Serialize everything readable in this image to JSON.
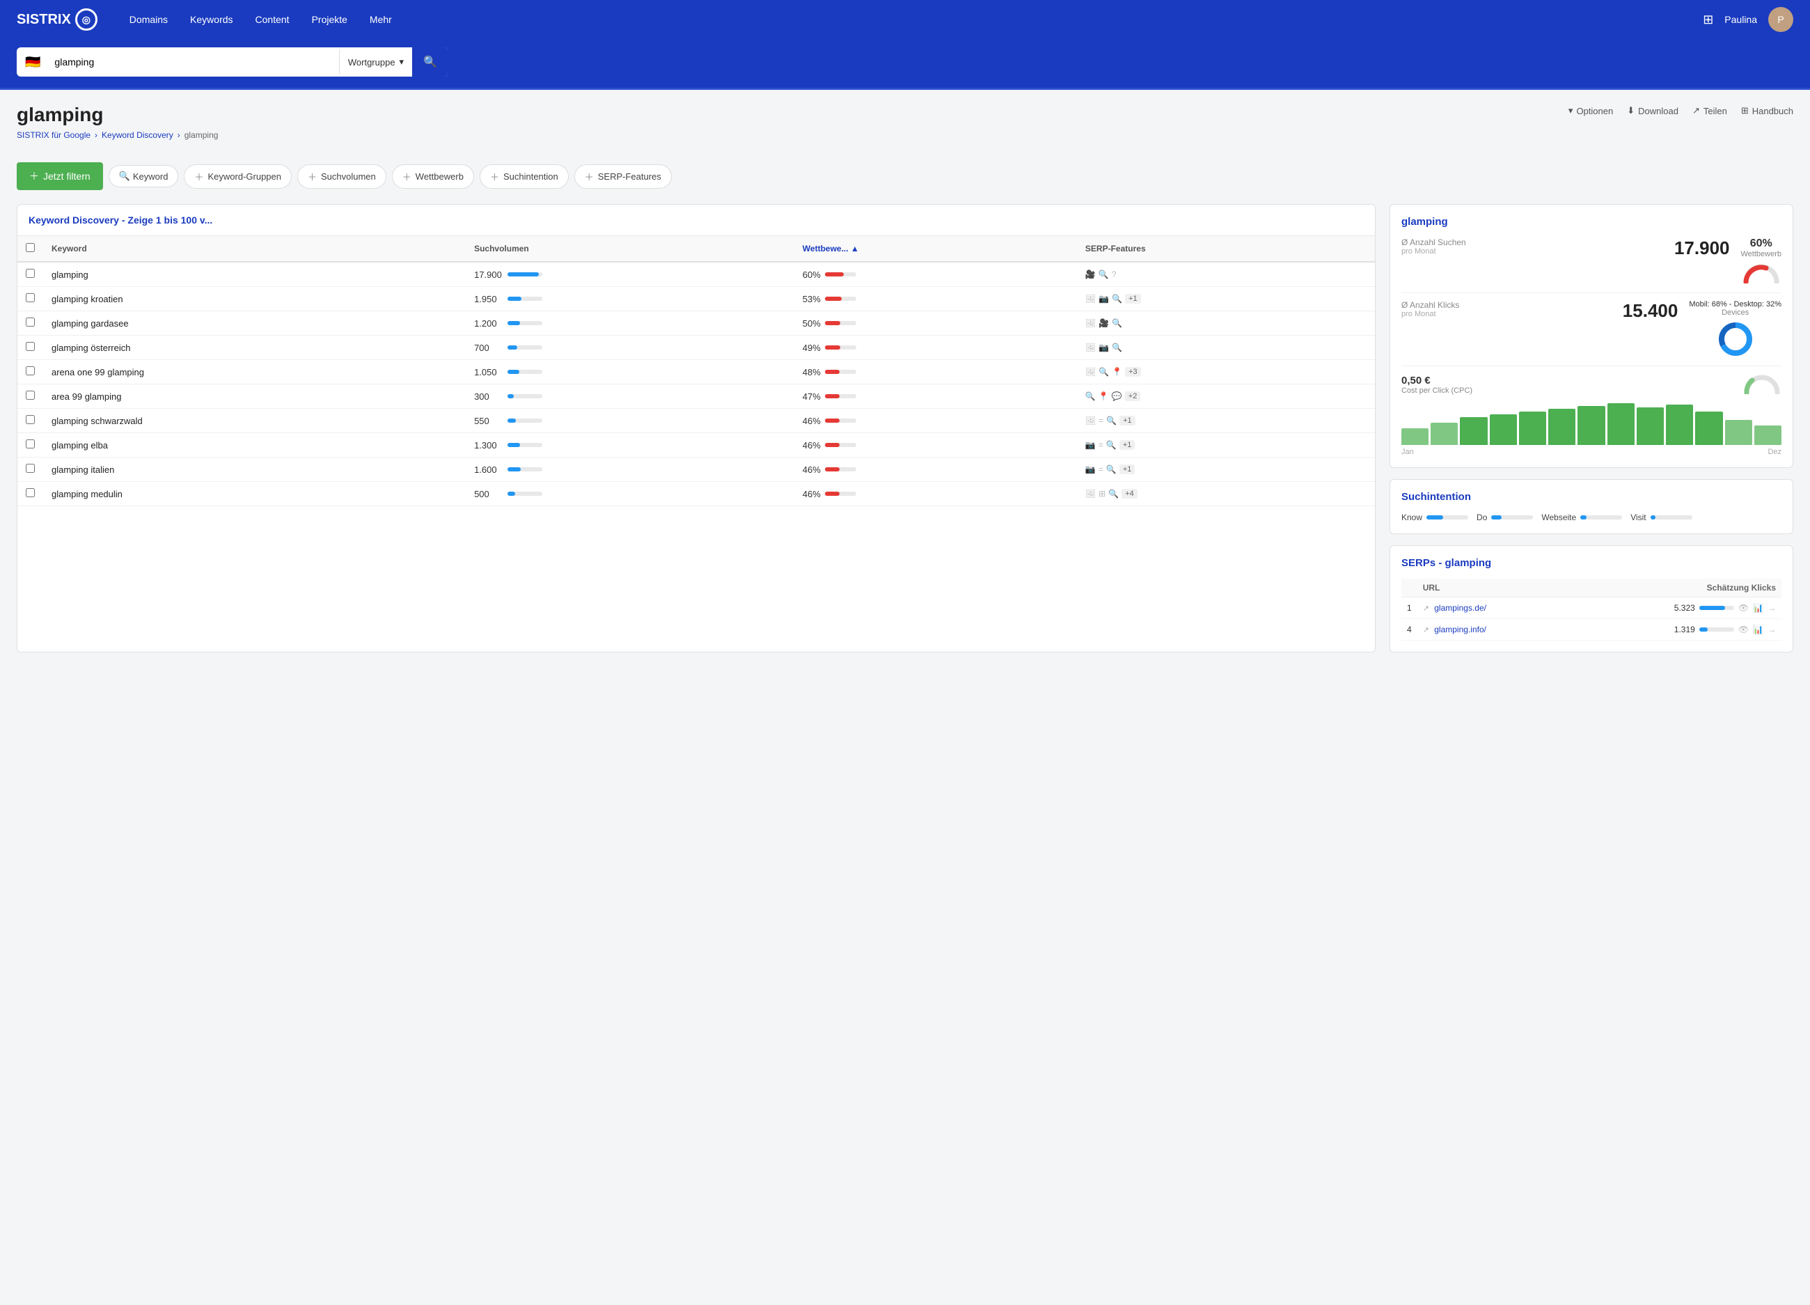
{
  "nav": {
    "logo": "SISTRIX",
    "links": [
      "Domains",
      "Keywords",
      "Content",
      "Projekte",
      "Mehr"
    ],
    "user": "Paulina"
  },
  "search": {
    "query": "glamping",
    "filter": "Wortgruppe",
    "flag": "🇩🇪"
  },
  "page": {
    "title": "glamping",
    "breadcrumb": [
      "SISTRIX für Google",
      "Keyword Discovery",
      "glamping"
    ],
    "actions": [
      "Optionen",
      "Download",
      "Teilen",
      "Handbuch"
    ]
  },
  "filters": {
    "button": "Jetzt filtern",
    "pills": [
      "Keyword",
      "Keyword-Gruppen",
      "Suchvolumen",
      "Wettbewerb",
      "Suchintention",
      "SERP-Features"
    ]
  },
  "table": {
    "title": "Keyword Discovery - Zeige 1 bis 100 v...",
    "columns": [
      "Keyword",
      "Suchvolumen",
      "Wettbewe...",
      "SERP-Features"
    ],
    "rows": [
      {
        "keyword": "glamping",
        "volume": "17.900",
        "vol_bar": 90,
        "wett": "60%",
        "wett_bar": 60,
        "serp": [
          "🎥",
          "🔍",
          "?"
        ]
      },
      {
        "keyword": "glamping kroatien",
        "volume": "1.950",
        "vol_bar": 40,
        "wett": "53%",
        "wett_bar": 53,
        "serp": [
          "🖼",
          "📷",
          "🔍",
          "+1"
        ]
      },
      {
        "keyword": "glamping gardasee",
        "volume": "1.200",
        "vol_bar": 35,
        "wett": "50%",
        "wett_bar": 50,
        "serp": [
          "🖼",
          "🎥",
          "🔍"
        ]
      },
      {
        "keyword": "glamping österreich",
        "volume": "700",
        "vol_bar": 28,
        "wett": "49%",
        "wett_bar": 49,
        "serp": [
          "🖼",
          "📷",
          "🔍"
        ]
      },
      {
        "keyword": "arena one 99 glamping",
        "volume": "1.050",
        "vol_bar": 33,
        "wett": "48%",
        "wett_bar": 48,
        "serp": [
          "🖼",
          "🔍",
          "📍",
          "+3"
        ]
      },
      {
        "keyword": "area 99 glamping",
        "volume": "300",
        "vol_bar": 18,
        "wett": "47%",
        "wett_bar": 47,
        "serp": [
          "🔍",
          "📍",
          "💬",
          "+2"
        ]
      },
      {
        "keyword": "glamping schwarzwald",
        "volume": "550",
        "vol_bar": 24,
        "wett": "46%",
        "wett_bar": 46,
        "serp": [
          "🖼",
          "=",
          "🔍",
          "+1"
        ]
      },
      {
        "keyword": "glamping elba",
        "volume": "1.300",
        "vol_bar": 36,
        "wett": "46%",
        "wett_bar": 46,
        "serp": [
          "📷",
          "=",
          "🔍",
          "+1"
        ]
      },
      {
        "keyword": "glamping italien",
        "volume": "1.600",
        "vol_bar": 38,
        "wett": "46%",
        "wett_bar": 46,
        "serp": [
          "📷",
          "=",
          "🔍",
          "+1"
        ]
      },
      {
        "keyword": "glamping medulin",
        "volume": "500",
        "vol_bar": 22,
        "wett": "46%",
        "wett_bar": 46,
        "serp": [
          "🖼",
          "⊞",
          "🔍",
          "+4"
        ]
      }
    ]
  },
  "right_panel": {
    "keyword": "glamping",
    "avg_searches": {
      "label": "Ø Anzahl Suchen",
      "sublabel": "pro Monat",
      "value": "17.900"
    },
    "competition": {
      "value": "60%",
      "label": "Wettbewerb"
    },
    "avg_clicks": {
      "label": "Ø Anzahl Klicks",
      "sublabel": "pro Monat",
      "value": "15.400"
    },
    "devices": {
      "value": "Mobil: 68% - Desktop: 32%",
      "label": "Devices"
    },
    "cpc": {
      "value": "0,50 €",
      "label": "Cost per Click (CPC)"
    },
    "chart_bars": [
      30,
      40,
      50,
      55,
      60,
      65,
      70,
      75,
      68,
      72,
      60,
      45,
      35
    ],
    "chart_start": "Jan",
    "chart_end": "Dez",
    "suchintention": {
      "title": "Suchintention",
      "items": [
        {
          "label": "Know",
          "fill": 40
        },
        {
          "label": "Do",
          "fill": 25
        },
        {
          "label": "Webseite",
          "fill": 15
        },
        {
          "label": "Visit",
          "fill": 12
        }
      ]
    },
    "serps": {
      "title": "SERPs - glamping",
      "col1": "URL",
      "col2": "Schätzung Klicks",
      "rows": [
        {
          "rank": "1",
          "url": "glampings.de/",
          "clicks": "5.323",
          "bar": 75
        },
        {
          "rank": "4",
          "url": "glamping.info/",
          "clicks": "1.319",
          "bar": 25
        }
      ]
    }
  }
}
